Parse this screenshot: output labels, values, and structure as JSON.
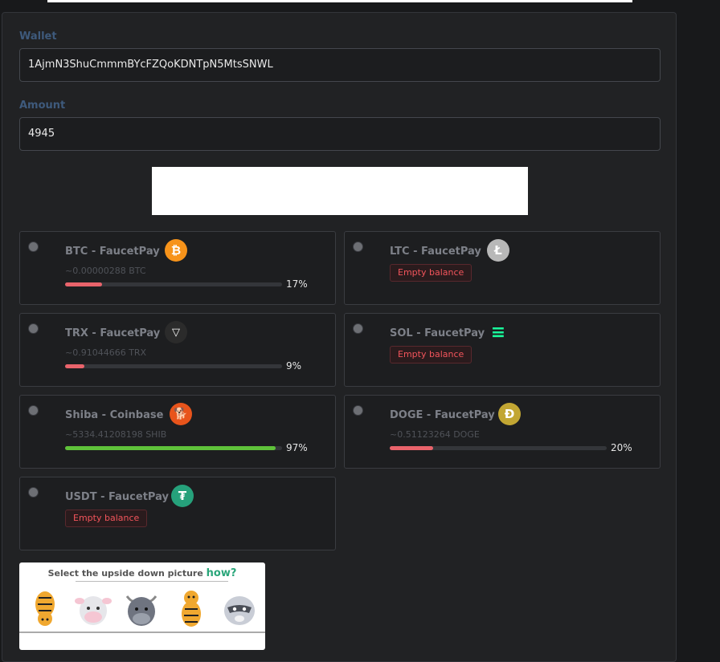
{
  "form": {
    "wallet_label": "Wallet",
    "wallet_value": "1AjmN3ShuCmmmBYcFZQoKDNTpN5MtsSNWL",
    "amount_label": "Amount",
    "amount_value": "4945"
  },
  "currencies": [
    {
      "title": "BTC - FaucetPay",
      "icon": "bitcoin-icon",
      "icon_glyph": "₿",
      "icon_color": "#f7931a",
      "amount": "~0.00000288 BTC",
      "percent_label": "17%",
      "level": 0.17,
      "bar_color": "#e9636b"
    },
    {
      "title": "LTC - FaucetPay",
      "icon": "litecoin-icon",
      "icon_glyph": "Ł",
      "icon_color": "#b8b8b8",
      "status": "Empty balance"
    },
    {
      "title": "TRX - FaucetPay",
      "icon": "tron-icon",
      "icon_glyph": "▽",
      "icon_color": "#2b2b2b",
      "amount": "~0.91044666 TRX",
      "percent_label": "9%",
      "level": 0.09,
      "bar_color": "#e9636b"
    },
    {
      "title": "SOL - FaucetPay",
      "icon": "solana-icon",
      "icon_glyph": "≡",
      "icon_color": "#9945ff",
      "status": "Empty balance"
    },
    {
      "title": "Shiba - Coinbase",
      "icon": "shiba-inu-icon",
      "icon_glyph": "🐕",
      "icon_color": "#e8541b",
      "amount": "~5334.41208198 SHIB",
      "percent_label": "97%",
      "level": 0.97,
      "bar_color": "#5fc23a"
    },
    {
      "title": "DOGE - FaucetPay",
      "icon": "dogecoin-icon",
      "icon_glyph": "Ð",
      "icon_color": "#c2a633",
      "amount": "~0.51123264 DOGE",
      "percent_label": "20%",
      "level": 0.2,
      "bar_color": "#e9636b"
    },
    {
      "title": "USDT - FaucetPay",
      "icon": "tether-icon",
      "icon_glyph": "₮",
      "icon_color": "#26a17b",
      "status": "Empty balance"
    }
  ],
  "captcha": {
    "prompt": "Select the upside down picture",
    "help_link": "how?",
    "options": [
      "tiger-upside-down",
      "cow",
      "bull",
      "tiger",
      "raccoon"
    ]
  },
  "colors": {
    "background": "#18191b",
    "panel": "#212224",
    "label": "#3e5a7c",
    "progress_low": "#e9636b",
    "progress_high": "#5fc23a",
    "empty_badge": "#f2545b"
  }
}
